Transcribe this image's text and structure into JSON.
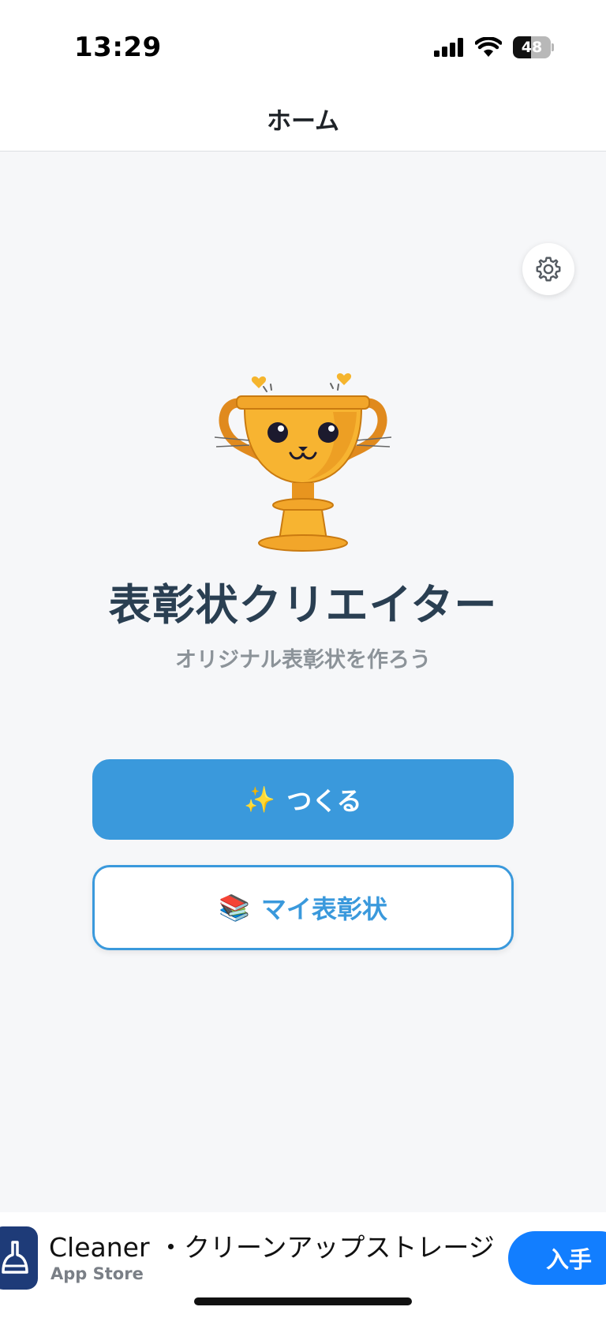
{
  "status_bar": {
    "time": "13:29",
    "battery": "48",
    "icons": [
      "cellular-signal-icon",
      "wifi-icon",
      "battery-icon"
    ]
  },
  "nav": {
    "title": "ホーム"
  },
  "settings": {
    "icon": "gear-icon"
  },
  "hero": {
    "mascot": "trophy-mascot-icon",
    "title": "表彰状クリエイター",
    "subtitle": "オリジナル表彰状を作ろう"
  },
  "actions": {
    "create": {
      "emoji": "✨",
      "label": "つくる"
    },
    "mine": {
      "emoji": "📚",
      "label": "マイ表彰状"
    }
  },
  "ad": {
    "title": "Cleaner ・クリーンアップストレージ",
    "store": "App Store",
    "cta": "入手",
    "icon": "cleaner-app-icon"
  },
  "colors": {
    "accent": "#3a99dc",
    "title": "#2a3f52",
    "subtitle": "#8c9399",
    "background": "#f6f7f9",
    "ad_cta": "#127eff"
  }
}
